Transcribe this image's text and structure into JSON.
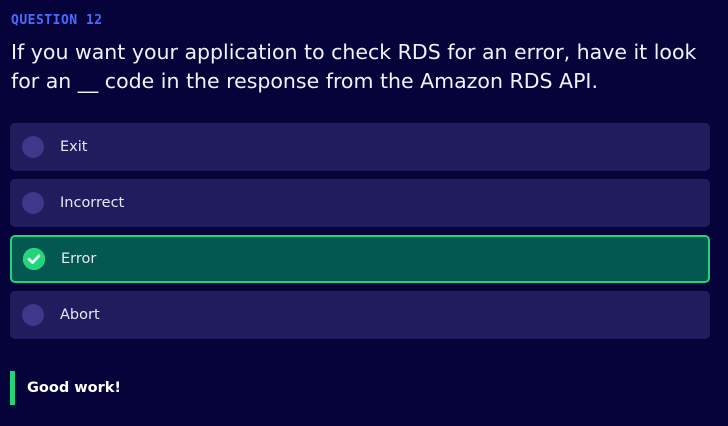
{
  "question": {
    "label": "QUESTION 12",
    "text": "If you want your application to check RDS for an error, have it look for an __ code in the response from the Amazon RDS API."
  },
  "options": [
    {
      "label": "Exit",
      "state": "unselected"
    },
    {
      "label": "Incorrect",
      "state": "unselected"
    },
    {
      "label": "Error",
      "state": "correct"
    },
    {
      "label": "Abort",
      "state": "unselected"
    }
  ],
  "feedback": {
    "text": "Good work!"
  },
  "colors": {
    "background": "#05033a",
    "question_label": "#4b6bff",
    "option_bg": "#201c5e",
    "correct_bg": "#03594f",
    "correct_border": "#20d57b"
  },
  "icons": {
    "radio": "radio-circle-icon",
    "correct": "checkmark-icon"
  }
}
